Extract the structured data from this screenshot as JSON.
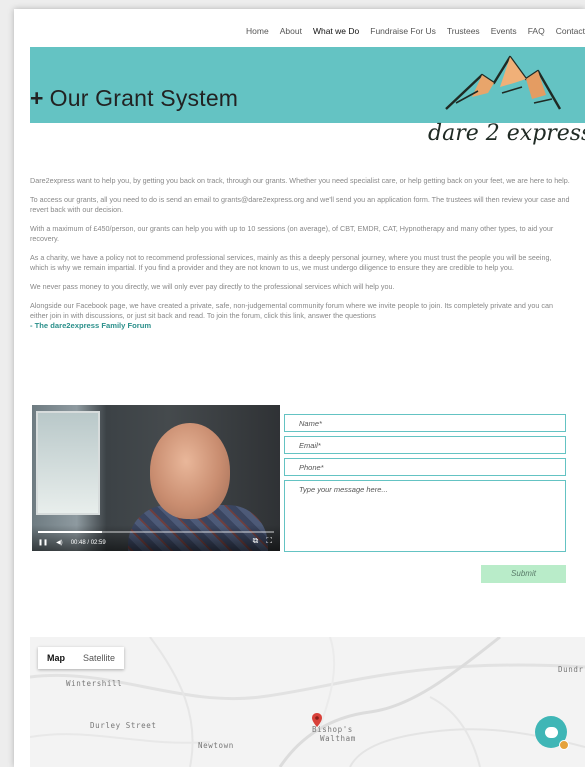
{
  "nav": {
    "items": [
      "Home",
      "About",
      "What we Do",
      "Fundraise For Us",
      "Trustees",
      "Events",
      "FAQ",
      "Contact"
    ],
    "active": "What we Do"
  },
  "banner": {
    "plus": "+",
    "title": "Our Grant System",
    "logo_text": "dare 2 express",
    "color": "#64c3c3"
  },
  "content": {
    "p1": "Dare2express want to help you, by getting you back on track, through our grants. Whether you need specialist care, or help getting back on your feet, we are here to help.",
    "p2": "To access our grants, all you need to do is send an email to grants@dare2express.org and we'll send you an application form. The trustees will then review your case and revert back with our decision.",
    "p3": "With a maximum of £450/person, our grants can help you with up to 10 sessions (on average), of CBT, EMDR, CAT, Hypnotherapy and many other types, to aid your recovery.",
    "p4": "As a charity, we have a policy not to recommend professional services, mainly as this a deeply personal journey, where you must trust the people you will be seeing, which is why we remain impartial. If you find a provider and they are not known to us, we must undergo diligence to ensure they are credible to help you.",
    "p5": "We never pass money to you directly, we will only ever pay directly to the professional services which will help you.",
    "p6": "Alongside our Facebook page, we have created a private, safe, non-judgemental community forum where we invite people to join. Its completely private and you can either join in with discussions, or just sit back and read. To join the forum, click this link, answer the questions",
    "forum_link": "- The dare2express Family Forum"
  },
  "video": {
    "time": "00:48 / 02:59",
    "progress": 0.27
  },
  "form": {
    "name_placeholder": "Name*",
    "email_placeholder": "Email*",
    "phone_placeholder": "Phone*",
    "message_placeholder": "Type your message here...",
    "submit_label": "Submit"
  },
  "map": {
    "tab_map": "Map",
    "tab_satellite": "Satellite",
    "labels": {
      "wintershill": "Wintershill",
      "durley_street": "Durley Street",
      "newtown": "Newtown",
      "dundridge": "Dundr",
      "bishops_waltham_1": "Bishop's",
      "bishops_waltham_2": "Waltham"
    }
  },
  "chat": {
    "icon": "chat-icon",
    "accent": "#3fb6b6"
  }
}
